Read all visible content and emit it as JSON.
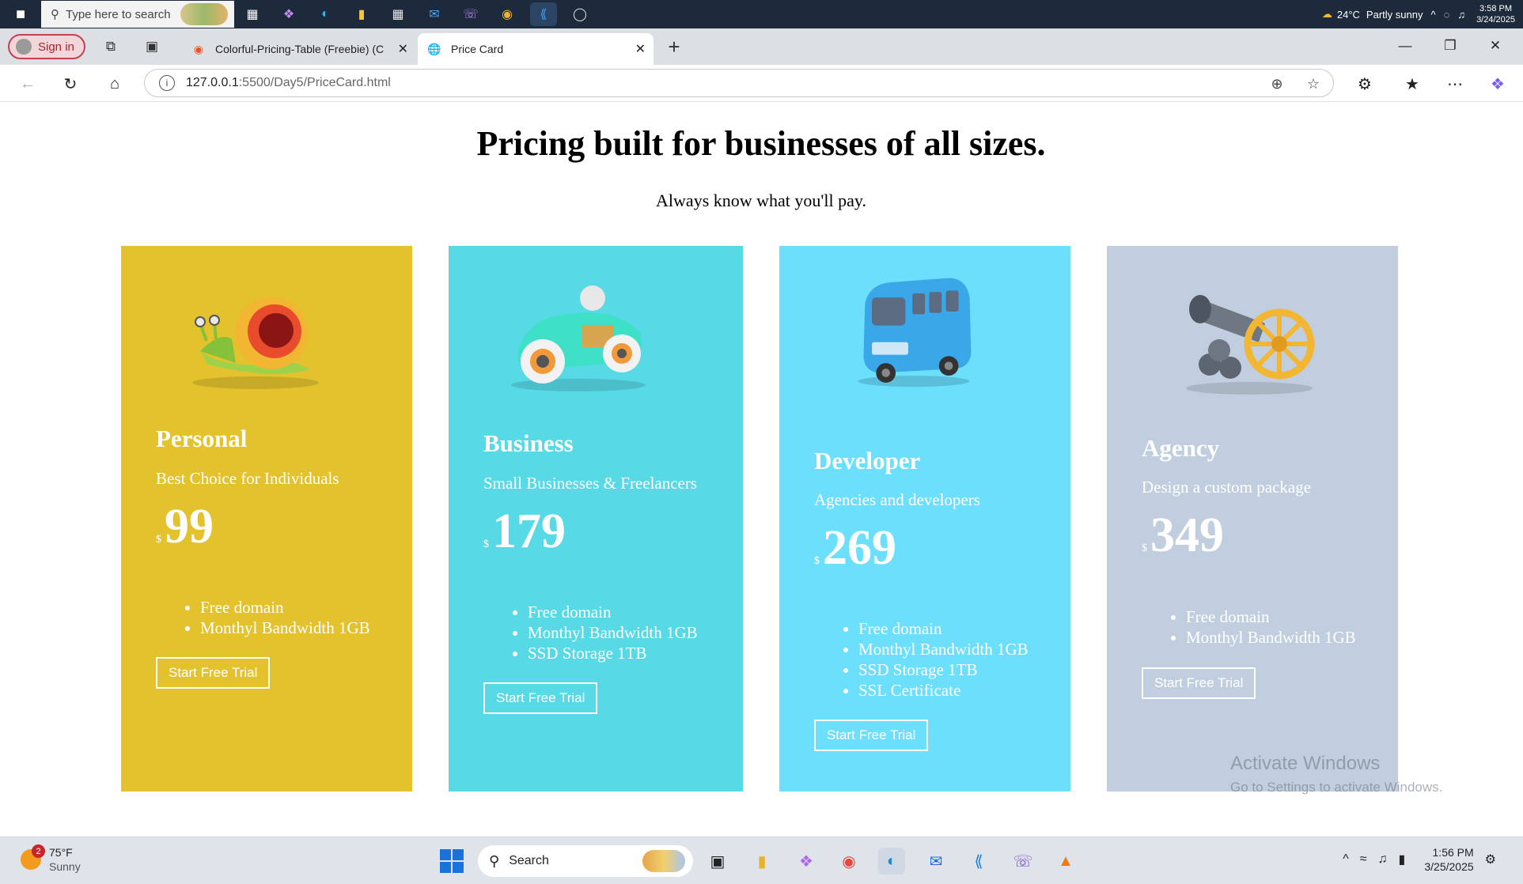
{
  "outer_taskbar": {
    "search_placeholder": "Type here to search",
    "weather_temp": "24°C",
    "weather_condition": "Partly sunny",
    "time": "3:58 PM",
    "date": "3/24/2025"
  },
  "browser": {
    "signin_label": "Sign in",
    "tabs": [
      {
        "title": "Colorful-Pricing-Table (Freebie) (C"
      },
      {
        "title": "Price Card"
      }
    ],
    "url_host": "127.0.0.1",
    "url_path": ":5500/Day5/PriceCard.html"
  },
  "page": {
    "heading": "Pricing built for businesses of all sizes.",
    "subheading": "Always know what you'll pay.",
    "cta_label": "Start Free Trial",
    "cards": [
      {
        "title": "Personal",
        "tagline": "Best Choice for Individuals",
        "currency": "$",
        "price": "99",
        "features": [
          "Free domain",
          "Monthyl Bandwidth 1GB"
        ],
        "color": "#e3c22e",
        "art": "snail-icon"
      },
      {
        "title": "Business",
        "tagline": "Small Businesses & Freelancers",
        "currency": "$",
        "price": "179",
        "features": [
          "Free domain",
          "Monthyl Bandwidth 1GB",
          "SSD Storage 1TB"
        ],
        "color": "#57d9e6",
        "art": "race-car-icon"
      },
      {
        "title": "Developer",
        "tagline": "Agencies and developers",
        "currency": "$",
        "price": "269",
        "features": [
          "Free domain",
          "Monthyl Bandwidth 1GB",
          "SSD Storage 1TB",
          "SSL Certificate"
        ],
        "color": "#6cdffd",
        "art": "bus-icon"
      },
      {
        "title": "Agency",
        "tagline": "Design a custom package",
        "currency": "$",
        "price": "349",
        "features": [
          "Free domain",
          "Monthyl Bandwidth 1GB"
        ],
        "color": "#c0cedf",
        "art": "cannon-icon"
      }
    ]
  },
  "watermark": {
    "line1": "Activate Windows",
    "line2": "Go to Settings to activate Windows."
  },
  "bottom_taskbar": {
    "weather_temp": "75°F",
    "weather_condition": "Sunny",
    "weather_badge": "2",
    "search_placeholder": "Search",
    "time": "1:56 PM",
    "date": "3/25/2025"
  }
}
